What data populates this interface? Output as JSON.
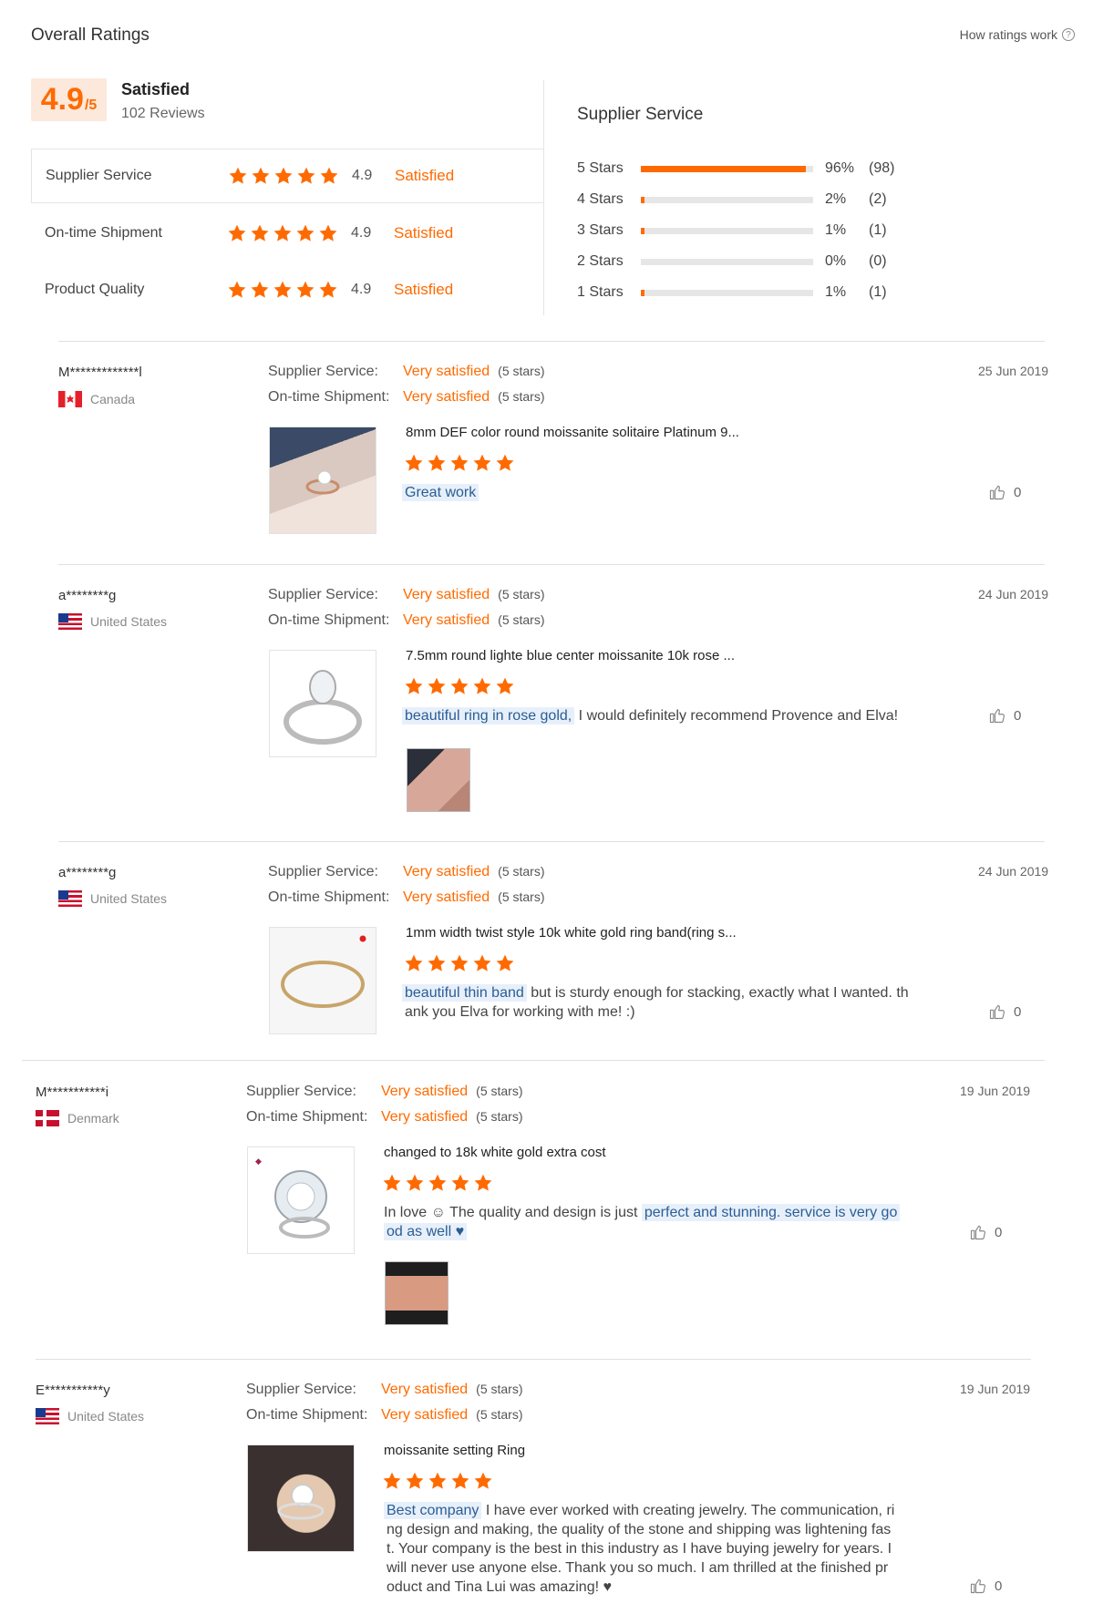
{
  "overall": {
    "title": "Overall Ratings",
    "how_link": "How ratings work",
    "score": "4.9",
    "score_den": "/5",
    "status": "Satisfied",
    "reviews": "102 Reviews",
    "rows": [
      {
        "label": "Supplier Service",
        "score": "4.9",
        "status": "Satisfied",
        "stars": 5
      },
      {
        "label": "On-time Shipment",
        "score": "4.9",
        "status": "Satisfied",
        "stars": 5
      },
      {
        "label": "Product Quality",
        "score": "4.9",
        "status": "Satisfied",
        "stars": 5
      }
    ]
  },
  "distribution": {
    "title": "Supplier Service",
    "rows": [
      {
        "label": "5 Stars",
        "pct": "96%",
        "count": "(98)",
        "fraction": 0.96
      },
      {
        "label": "4 Stars",
        "pct": "2%",
        "count": "(2)",
        "fraction": 0.02
      },
      {
        "label": "3 Stars",
        "pct": "1%",
        "count": "(1)",
        "fraction": 0.01
      },
      {
        "label": "2 Stars",
        "pct": "0%",
        "count": "(0)",
        "fraction": 0.0
      },
      {
        "label": "1 Stars",
        "pct": "1%",
        "count": "(1)",
        "fraction": 0.01
      }
    ]
  },
  "labels": {
    "supplier_service": "Supplier Service:",
    "ontime_shipment": "On-time Shipment:",
    "very_satisfied": "Very satisfied",
    "five_stars": "(5 stars)"
  },
  "colors": {
    "accent": "#ff6a00",
    "highlight_bg": "#e7f0fa",
    "highlight_text": "#2b5d94"
  },
  "reviews": [
    {
      "user": "M*************l",
      "country": "Canada",
      "flag": "canada-flag",
      "date": "25 Jun 2019",
      "product": "8mm DEF color round moissanite solitaire Platinum 9...",
      "text_hl": "Great work",
      "text_rest": "",
      "likes": "0"
    },
    {
      "user": "a********g",
      "country": "United States",
      "flag": "us-flag",
      "date": "24 Jun 2019",
      "product": "7.5mm round lighte blue center moissanite 10k rose ...",
      "text_hl": "beautiful ring in rose gold,",
      "text_rest": " I would definitely recommend Provence and Elva!",
      "likes": "0"
    },
    {
      "user": "a********g",
      "country": "United States",
      "flag": "us-flag",
      "date": "24 Jun 2019",
      "product": "1mm width twist style 10k white gold ring band(ring s...",
      "text_hl": "beautiful thin band",
      "text_rest": " but is sturdy enough for stacking, exactly what I wanted. th",
      "text_line2": "ank you Elva for working with me! :)",
      "likes": "0"
    },
    {
      "user": "M***********i",
      "country": "Denmark",
      "flag": "denmark-flag",
      "date": "19 Jun 2019",
      "product": "changed to 18k white gold extra cost",
      "text_pre": "In love ☺ The quality and design is just ",
      "text_hl": "perfect and stunning. service is very go",
      "text_hl2": "od as well ♥",
      "likes": "0"
    },
    {
      "user": "E***********y",
      "country": "United States",
      "flag": "us-flag",
      "date": "19 Jun 2019",
      "product": "moissanite setting Ring",
      "text_hl": "Best company",
      "text_rest": " I have ever worked with creating jewelry.  The communication, ri",
      "text_line2": "ng design and making, the quality of the stone and shipping was lightening fas",
      "text_line3": "t. Your company is the best in this industry as I have buying jewelry for years.  I",
      "text_line4": "will never use anyone else.  Thank you so much.  I am thrilled at the finished pr",
      "text_line5": "oduct and Tina Lui was amazing! ♥",
      "likes": "0"
    }
  ]
}
